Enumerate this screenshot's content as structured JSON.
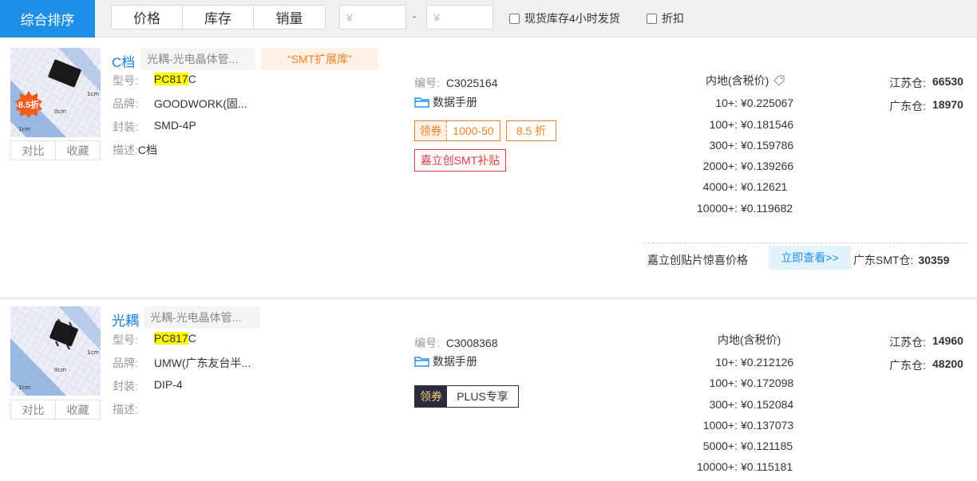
{
  "filter_bar": {
    "sort_default": "综合排序",
    "sort_options": [
      "价格",
      "库存",
      "销量"
    ],
    "price_min_placeholder": "¥",
    "price_separator": "-",
    "price_max_placeholder": "¥",
    "checkbox_instock": "现货库存4小时发货",
    "checkbox_discount": "折扣"
  },
  "products": [
    {
      "discount_badge": "8.5折",
      "compare_label": "对比",
      "favorite_label": "收藏",
      "category": "C档",
      "category_tag": "光耦-光电晶体管...",
      "smt_tag": "“SMT扩展库”",
      "model_label": "型号:",
      "model_highlight": "PC817",
      "model_suffix": "C",
      "brand_label": "品牌:",
      "brand_value": "GOODWORK(固...",
      "package_label": "封装:",
      "package_value": "SMD-4P",
      "desc_label": "描述:",
      "desc_value": "C档",
      "code_label": "编号:",
      "code_value": "C3025164",
      "datasheet_label": "数据手册",
      "coupon_label": "领券",
      "coupon_value": "1000-50",
      "discount_value": "8.5 折",
      "subsidy_label": "嘉立创SMT补贴",
      "price_header": "内地(含税价)",
      "price_tiers": [
        {
          "qty": "10+:",
          "price": "¥0.225067"
        },
        {
          "qty": "100+:",
          "price": "¥0.181546"
        },
        {
          "qty": "300+:",
          "price": "¥0.159786"
        },
        {
          "qty": "2000+:",
          "price": "¥0.139266"
        },
        {
          "qty": "4000+:",
          "price": "¥0.12621"
        },
        {
          "qty": "10000+:",
          "price": "¥0.119682"
        }
      ],
      "stock": [
        {
          "name": "江苏仓:",
          "qty": "66530"
        },
        {
          "name": "广东仓:",
          "qty": "18970"
        }
      ],
      "smt_promo_label": "嘉立创贴片惊喜价格",
      "smt_promo_button": "立即查看>>",
      "smt_stock_label": "广东SMT仓:",
      "smt_stock_qty": "30359"
    },
    {
      "compare_label": "对比",
      "favorite_label": "收藏",
      "category": "光耦",
      "category_tag": "光耦-光电晶体管...",
      "model_label": "型号:",
      "model_highlight": "PC817",
      "model_suffix": "C",
      "brand_label": "品牌:",
      "brand_value": "UMW(广东友台半...",
      "package_label": "封装:",
      "package_value": "DIP-4",
      "desc_label": "描述:",
      "desc_value": "",
      "code_label": "编号:",
      "code_value": "C3008368",
      "datasheet_label": "数据手册",
      "coupon_label": "领券",
      "plus_label": "PLUS专享",
      "price_header": "内地(含税价)",
      "price_tiers": [
        {
          "qty": "10+:",
          "price": "¥0.212126"
        },
        {
          "qty": "100+:",
          "price": "¥0.172098"
        },
        {
          "qty": "300+:",
          "price": "¥0.152084"
        },
        {
          "qty": "1000+:",
          "price": "¥0.137073"
        },
        {
          "qty": "5000+:",
          "price": "¥0.121185"
        },
        {
          "qty": "10000+:",
          "price": "¥0.115181"
        }
      ],
      "stock": [
        {
          "name": "江苏仓:",
          "qty": "14960"
        },
        {
          "name": "广东仓:",
          "qty": "48200"
        }
      ]
    }
  ]
}
